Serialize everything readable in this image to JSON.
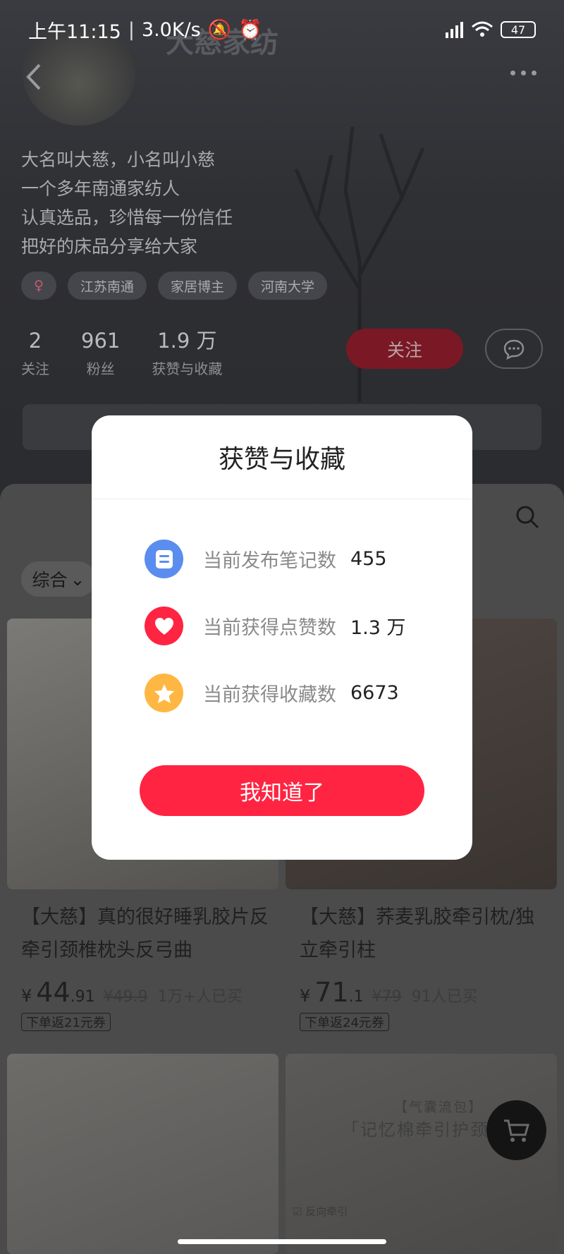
{
  "status_bar": {
    "time": "上午11:15",
    "speed": "3.0K/s",
    "battery": "47"
  },
  "profile": {
    "name": "大慈家纺",
    "bio": [
      "大名叫大慈，小名叫小慈",
      "一个多年南通家纺人",
      "认真选品，珍惜每一份信任",
      "把好的床品分享给大家"
    ],
    "tags": [
      "♀",
      "江苏南通",
      "家居博主",
      "河南大学"
    ],
    "stats": [
      {
        "value": "2",
        "label": "关注"
      },
      {
        "value": "961",
        "label": "粉丝"
      },
      {
        "value": "1.9 万",
        "label": "获赞与收藏"
      }
    ],
    "follow_label": "关注"
  },
  "sort_label": "综合",
  "products": [
    {
      "title": "【大慈】真的很好睡乳胶片反牵引颈椎枕头反弓曲",
      "currency": "¥",
      "price_int": "44",
      "price_dec": ".91",
      "original": "¥49.9",
      "sold": "1万+人已买",
      "coupon": "下单返21元券"
    },
    {
      "title": "【大慈】荞麦乳胶牵引枕/独立牵引柱",
      "currency": "¥",
      "price_int": "71",
      "price_dec": ".1",
      "original": "¥79",
      "sold": "91人已买",
      "coupon": "下单返24元券"
    }
  ],
  "image_text": {
    "banner_top": "【气囊流包】",
    "banner": "「记忆棉牵引护颈枕",
    "check": "☑ 反向牵引"
  },
  "modal": {
    "title": "获赞与收藏",
    "rows": [
      {
        "icon": "note-icon",
        "label": "当前发布笔记数",
        "value": "455",
        "color": "#5b8def"
      },
      {
        "icon": "heart-icon",
        "label": "当前获得点赞数",
        "value": "1.3 万",
        "color": "#ff2442"
      },
      {
        "icon": "star-icon",
        "label": "当前获得收藏数",
        "value": "6673",
        "color": "#ffb743"
      }
    ],
    "button": "我知道了"
  }
}
